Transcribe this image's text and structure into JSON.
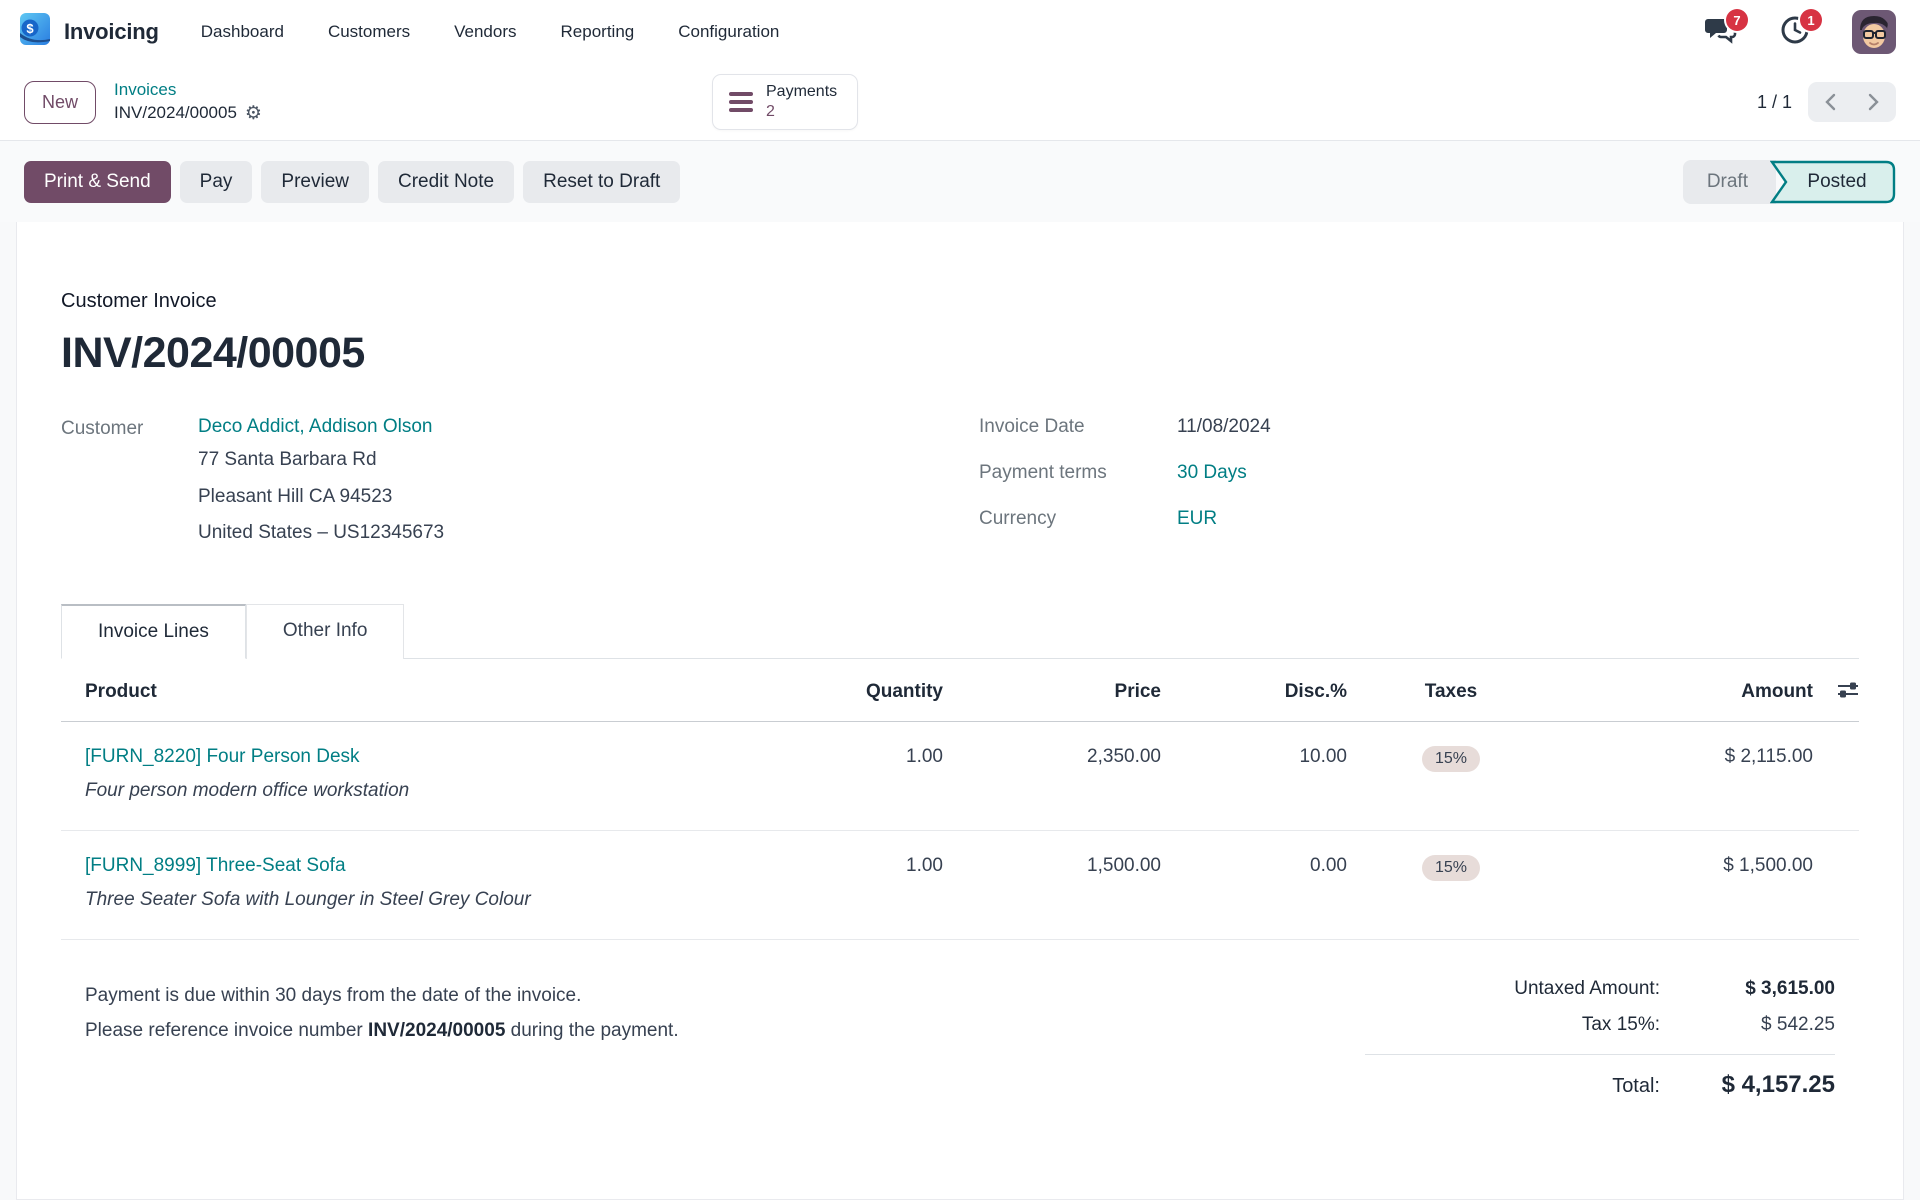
{
  "colors": {
    "primary": "#714B67",
    "link_teal": "#017e84",
    "badge_red": "#d73343",
    "posted_bg": "#d9efec",
    "posted_border": "#017e84"
  },
  "nav": {
    "app_name": "Invoicing",
    "logo_symbol": "$",
    "menu": [
      "Dashboard",
      "Customers",
      "Vendors",
      "Reporting",
      "Configuration"
    ],
    "messages_badge": "7",
    "activities_badge": "1"
  },
  "breadcrumb": {
    "new_button": "New",
    "parent": "Invoices",
    "current": "INV/2024/00005"
  },
  "payments_button": {
    "label": "Payments",
    "count": "2"
  },
  "pager": {
    "text": "1 / 1"
  },
  "actions": {
    "primary": "Print & Send",
    "secondary": [
      "Pay",
      "Preview",
      "Credit Note",
      "Reset to Draft"
    ]
  },
  "statusbar": {
    "draft": "Draft",
    "posted": "Posted"
  },
  "invoice": {
    "type_label": "Customer Invoice",
    "number": "INV/2024/00005",
    "customer_label": "Customer",
    "customer_name": "Deco Addict, Addison Olson",
    "address_lines": [
      "77 Santa Barbara Rd",
      "Pleasant Hill CA 94523",
      "United States – US12345673"
    ],
    "fields": [
      {
        "label": "Invoice Date",
        "value": "11/08/2024"
      },
      {
        "label": "Payment terms",
        "value": "30 Days"
      },
      {
        "label": "Currency",
        "value": "EUR"
      }
    ]
  },
  "tabs": [
    {
      "label": "Invoice Lines"
    },
    {
      "label": "Other Info"
    }
  ],
  "table": {
    "headers": [
      "Product",
      "Quantity",
      "Price",
      "Disc.%",
      "Taxes",
      "Amount"
    ],
    "rows": [
      {
        "product": "[FURN_8220] Four Person Desk",
        "description": "Four person modern office workstation",
        "quantity": "1.00",
        "price": "2,350.00",
        "discount": "10.00",
        "tax": "15%",
        "amount": "$ 2,115.00"
      },
      {
        "product": "[FURN_8999] Three-Seat Sofa",
        "description": "Three Seater Sofa with Lounger in Steel Grey Colour",
        "quantity": "1.00",
        "price": "1,500.00",
        "discount": "0.00",
        "tax": "15%",
        "amount": "$ 1,500.00"
      }
    ]
  },
  "footer": {
    "note_line1": "Payment is due within 30 days from the date of the invoice.",
    "note2_prefix": "Please reference invoice number ",
    "note2_bold": "INV/2024/00005",
    "note2_suffix": " during the payment.",
    "untaxed_label": "Untaxed Amount:",
    "untaxed_value": "$ 3,615.00",
    "tax_label": "Tax 15%:",
    "tax_value": "$ 542.25",
    "total_label": "Total:",
    "total_value": "$ 4,157.25"
  }
}
